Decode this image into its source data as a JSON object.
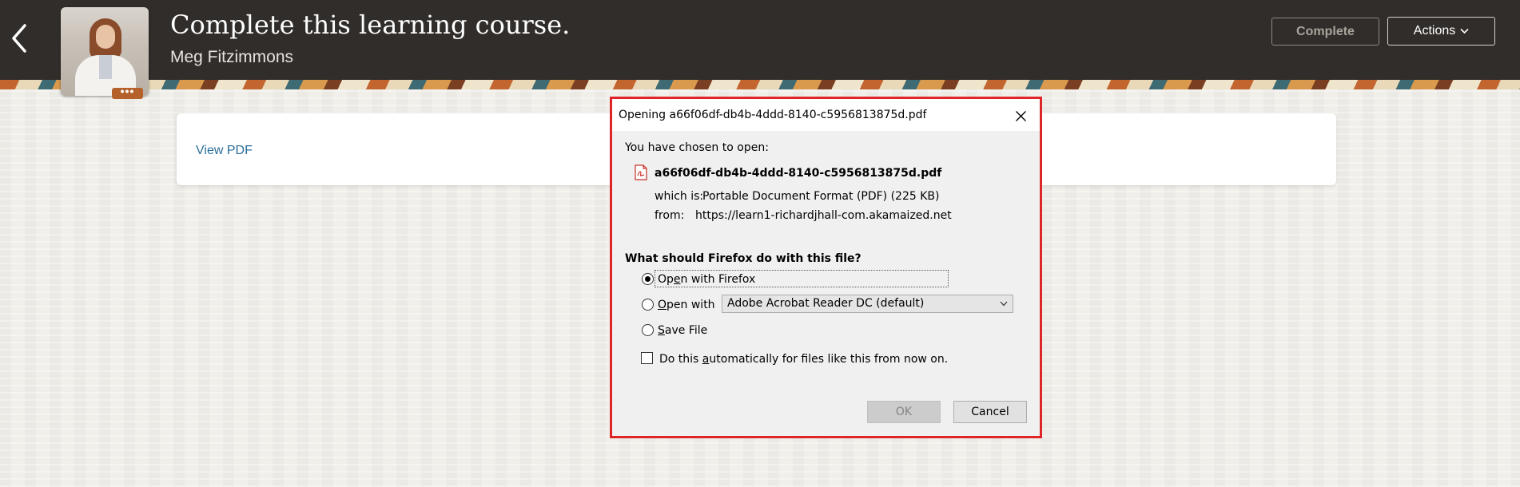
{
  "header": {
    "title": "Complete this learning course.",
    "subtitle": "Meg Fitzimmons",
    "more_label": "•••",
    "complete_label": "Complete",
    "actions_label": "Actions"
  },
  "card": {
    "link_label": "View PDF"
  },
  "dialog": {
    "title": "Opening a66f06df-db4b-4ddd-8140-c5956813875d.pdf",
    "chosen_label": "You have chosen to open:",
    "filename": "a66f06df-db4b-4ddd-8140-c5956813875d.pdf",
    "which_is_label": "which is:",
    "which_is_value": "Portable Document Format (PDF) (225 KB)",
    "from_label": "from:",
    "from_value": "https://learn1-richardjhall-com.akamaized.net",
    "question": "What should Firefox do with this file?",
    "options": [
      {
        "pre": "Op",
        "key": "e",
        "post": "n with Firefox",
        "checked": true
      },
      {
        "pre": "",
        "key": "O",
        "post": "pen with",
        "checked": false
      },
      {
        "pre": "",
        "key": "S",
        "post": "ave File",
        "checked": false
      }
    ],
    "open_with_app": "Adobe Acrobat Reader DC (default)",
    "auto_checkbox": {
      "pre": "Do this ",
      "key": "a",
      "post": "utomatically for files like this from now on.",
      "checked": false
    },
    "ok_label": "OK",
    "cancel_label": "Cancel"
  },
  "colors": {
    "header_bg": "#312d2a",
    "link": "#2a6e9c",
    "highlight_outline": "#e02529",
    "more_button": "#b4612c"
  }
}
